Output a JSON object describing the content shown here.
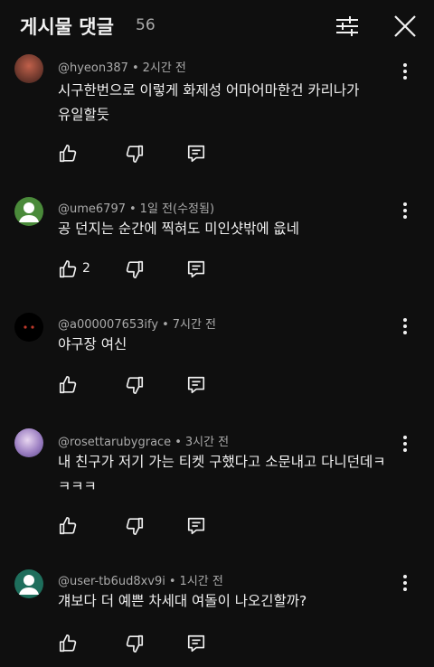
{
  "header": {
    "title": "게시물 댓글",
    "count": "56",
    "filter_icon": "sliders-icon",
    "close_icon": "close-icon"
  },
  "comments": [
    {
      "handle": "@hyeon387",
      "time": "2시간 전",
      "lines": [
        "시구한번으로 이렇게 화제성 어마어마한건 카리나가",
        "유일할듯"
      ],
      "likes": "",
      "avatar_color": "#6b3a2a"
    },
    {
      "handle": "@ume6797",
      "time": "1일 전(수정됨)",
      "lines": [
        "공 던지는 순간에 찍혀도 미인샷밖에 읎네"
      ],
      "likes": "2",
      "avatar_color": "#4a8a3a"
    },
    {
      "handle": "@a000007653ify",
      "time": "7시간 전",
      "lines": [
        "야구장 여신"
      ],
      "likes": "",
      "avatar_color": "#000000"
    },
    {
      "handle": "@rosettarubygrace",
      "time": "3시간 전",
      "lines": [
        "내 친구가 저기 가는 티켓 구했다고 소문내고 다니던데ㅋ",
        "ㅋㅋㅋ"
      ],
      "likes": "",
      "avatar_color": "#b9a3d6"
    },
    {
      "handle": "@user-tb6ud8xv9i",
      "time": "1시간 전",
      "lines": [
        "걔보다 더 예쁜 차세대 여돌이 나오긴할까?"
      ],
      "likes": "",
      "avatar_color": "#1e6e5c"
    }
  ]
}
